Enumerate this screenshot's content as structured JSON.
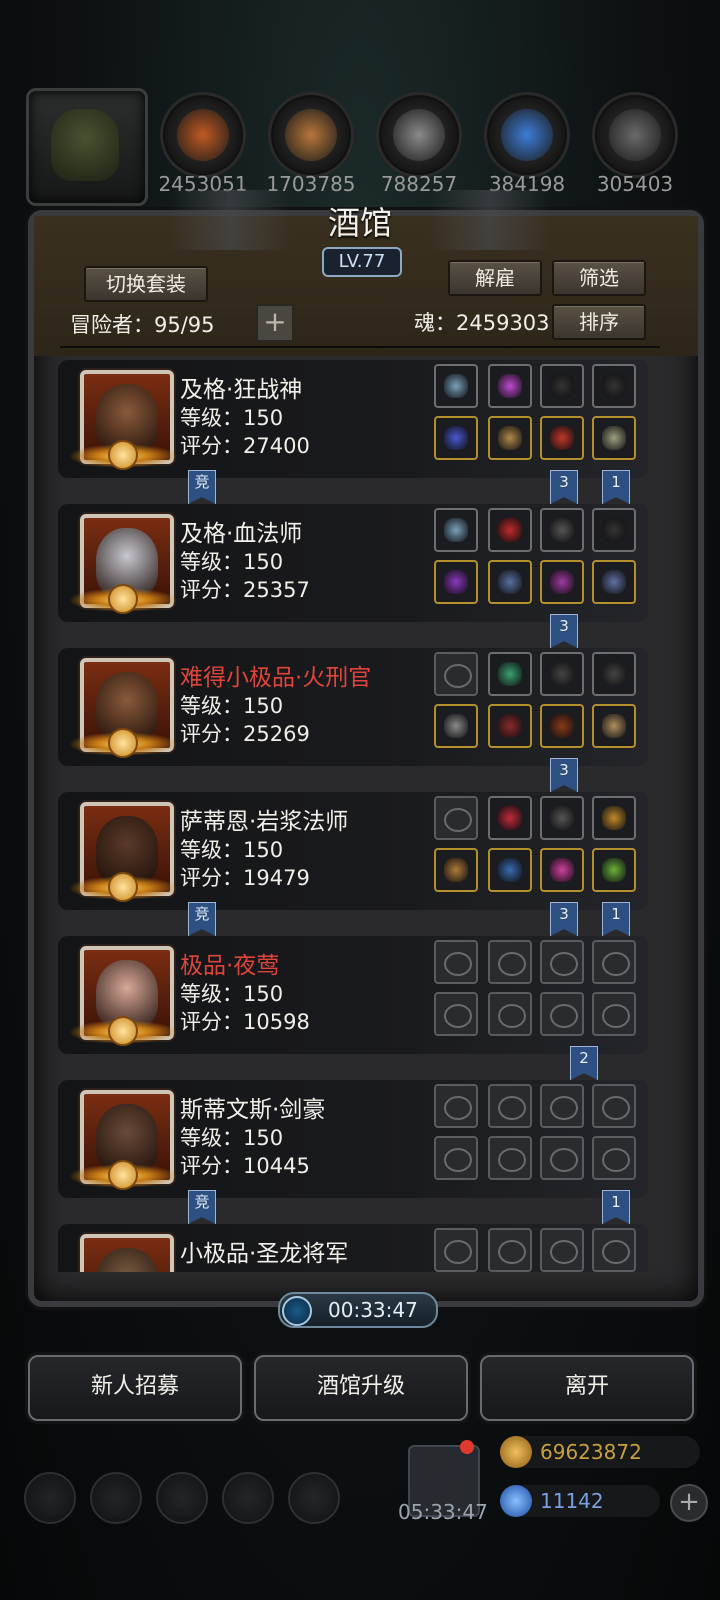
{
  "resources": [
    {
      "icon": "leather-icon",
      "value": "2453051",
      "color": "#c05a22"
    },
    {
      "icon": "wood-icon",
      "value": "1703785",
      "color": "#b7773a"
    },
    {
      "icon": "iron-icon",
      "value": "788257",
      "color": "#8a8a8a"
    },
    {
      "icon": "crystal-icon",
      "value": "384198",
      "color": "#3d7ed6"
    },
    {
      "icon": "ore-icon",
      "value": "305403",
      "color": "#6a6a6a"
    }
  ],
  "panel": {
    "title": "酒馆",
    "level": "LV.77",
    "switch_set": "切换套装",
    "dismiss": "解雇",
    "filter": "筛选",
    "sort": "排序",
    "adventurers_label": "冒险者：95/95",
    "soul_label": "魂：2459303",
    "plus": "+"
  },
  "heroes": [
    {
      "name": "及格·狂战神",
      "red": false,
      "level": "等级：150",
      "score": "评分：27400",
      "skin": "#8b5a3a",
      "left_tag": "竞",
      "tags": [
        {
          "slot": 2,
          "text": "3"
        },
        {
          "slot": 3,
          "text": "1"
        }
      ],
      "slots": [
        [
          "#7aa0b8",
          "#c04ad0",
          "#333",
          "#333"
        ],
        [
          "#4a5ad0",
          "#b08a4a",
          "#c0382a",
          "#a0a080"
        ]
      ],
      "empty": false
    },
    {
      "name": "及格·血法师",
      "red": false,
      "level": "等级：150",
      "score": "评分：25357",
      "skin": "#c8c8d0",
      "left_tag": "",
      "tags": [
        {
          "slot": 2,
          "text": "3"
        }
      ],
      "slots": [
        [
          "#7aa0b8",
          "#c02a2a",
          "#555",
          "#333"
        ],
        [
          "#8a3ac0",
          "#5a70a0",
          "#a03aa0",
          "#6070a0"
        ]
      ],
      "empty": false
    },
    {
      "name": "难得小极品·火刑官",
      "red": true,
      "level": "等级：150",
      "score": "评分：25269",
      "skin": "#8b5a3a",
      "left_tag": "",
      "tags": [
        {
          "slot": 2,
          "text": "3"
        }
      ],
      "slots": [
        [
          "empty",
          "#3aa070",
          "#444",
          "#444"
        ],
        [
          "#8a8a8a",
          "#8a2a2a",
          "#8a3a1a",
          "#b09060"
        ]
      ],
      "empty": false
    },
    {
      "name": "萨蒂恩·岩浆法师",
      "red": false,
      "level": "等级：150",
      "score": "评分：19479",
      "skin": "#5a3a28",
      "left_tag": "竞",
      "tags": [
        {
          "slot": 2,
          "text": "3"
        },
        {
          "slot": 3,
          "text": "1"
        }
      ],
      "slots": [
        [
          "empty",
          "#c02a3a",
          "#555",
          "#c08a2a"
        ],
        [
          "#b07a3a",
          "#3a6ab0",
          "#d040a0",
          "#6ab03a"
        ]
      ],
      "empty": false
    },
    {
      "name": "极品·夜莺",
      "red": true,
      "level": "等级：150",
      "score": "评分：10598",
      "skin": "#d8a898",
      "left_tag": "",
      "tags": [
        {
          "slot": 2.5,
          "text": "2"
        }
      ],
      "slots": [],
      "empty": true
    },
    {
      "name": "斯蒂文斯·剑豪",
      "red": false,
      "level": "等级：150",
      "score": "评分：10445",
      "skin": "#6a4a38",
      "left_tag": "竞",
      "tags": [
        {
          "slot": 3,
          "text": "1"
        }
      ],
      "slots": [],
      "empty": true
    },
    {
      "name": "小极品·圣龙将军",
      "red": false,
      "level": "",
      "score": "",
      "skin": "#7a5a40",
      "left_tag": "",
      "tags": [],
      "slots": [],
      "empty": true
    }
  ],
  "timer": "00:33:47",
  "buttons": {
    "recruit": "新人招募",
    "upgrade": "酒馆升级",
    "leave": "离开"
  },
  "gift_timer": "05:33:47",
  "gold": "69623872",
  "gems": "11142"
}
